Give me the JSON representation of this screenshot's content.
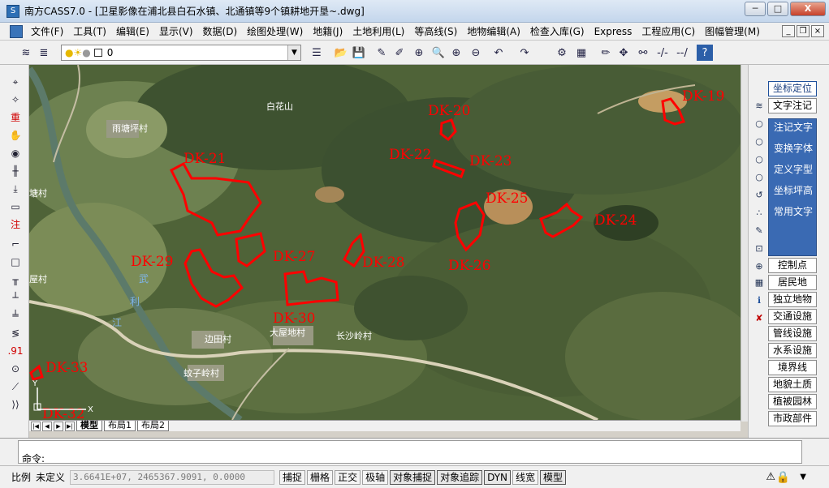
{
  "window": {
    "title": "南方CASS7.0 - [卫星影像在浦北县白石水镇、北通镇等9个镇耕地开垦~.dwg]",
    "app_icon_label": "S",
    "min_label": "─",
    "max_label": "□",
    "close_label": "X"
  },
  "menubar": {
    "items": [
      "文件(F)",
      "工具(T)",
      "编辑(E)",
      "显示(V)",
      "数据(D)",
      "绘图处理(W)",
      "地籍(J)",
      "土地利用(L)",
      "等高线(S)",
      "地物编辑(A)",
      "检查入库(G)",
      "Express",
      "工程应用(C)",
      "图幅管理(M)"
    ],
    "mdi_min": "_",
    "mdi_restore": "❐",
    "mdi_close": "×"
  },
  "toolbar": {
    "layer_value": "0"
  },
  "map": {
    "plots": [
      "DK-19",
      "DK-20",
      "DK-21",
      "DK-22",
      "DK-23",
      "DK-24",
      "DK-25",
      "DK-26",
      "DK-27",
      "DK-28",
      "DK-29",
      "DK-30",
      "DK-33",
      "DK-32"
    ],
    "places": [
      "白花山",
      "雨塘坪村",
      "塘村",
      "屋村",
      "边田村",
      "大屋地村",
      "长沙岭村",
      "蚊子岭村",
      "武",
      "利",
      "江"
    ],
    "ucs_y": "Y",
    "ucs_x": "X"
  },
  "tabs": {
    "items": [
      "模型",
      "布局1",
      "布局2"
    ],
    "nav": [
      "|◀",
      "◀",
      "▶",
      "▶|"
    ]
  },
  "rightpanel": {
    "top_buttons": [
      "坐标定位",
      "文字注记"
    ],
    "blue_items": [
      "注记文字",
      "变换字体",
      "定义字型",
      "坐标坪高",
      "常用文字"
    ],
    "buttons": [
      "控制点",
      "居民地",
      "独立地物",
      "交通设施",
      "管线设施",
      "水系设施",
      "境界线",
      "地貌土质",
      "植被园林",
      "市政部件"
    ]
  },
  "command": {
    "label": "命令:"
  },
  "status": {
    "scale_label": "比例",
    "scale_value": "未定义",
    "coords": "3.6641E+07, 2465367.9091, 0.0000",
    "toggles": [
      "捕捉",
      "栅格",
      "正交",
      "极轴",
      "对象捕捉",
      "对象追踪",
      "DYN",
      "线宽",
      "模型"
    ]
  },
  "colors": {
    "plot_outline": "#ff0000",
    "plot_label": "#ff0000",
    "panel_blue": "#3a6ab3"
  }
}
